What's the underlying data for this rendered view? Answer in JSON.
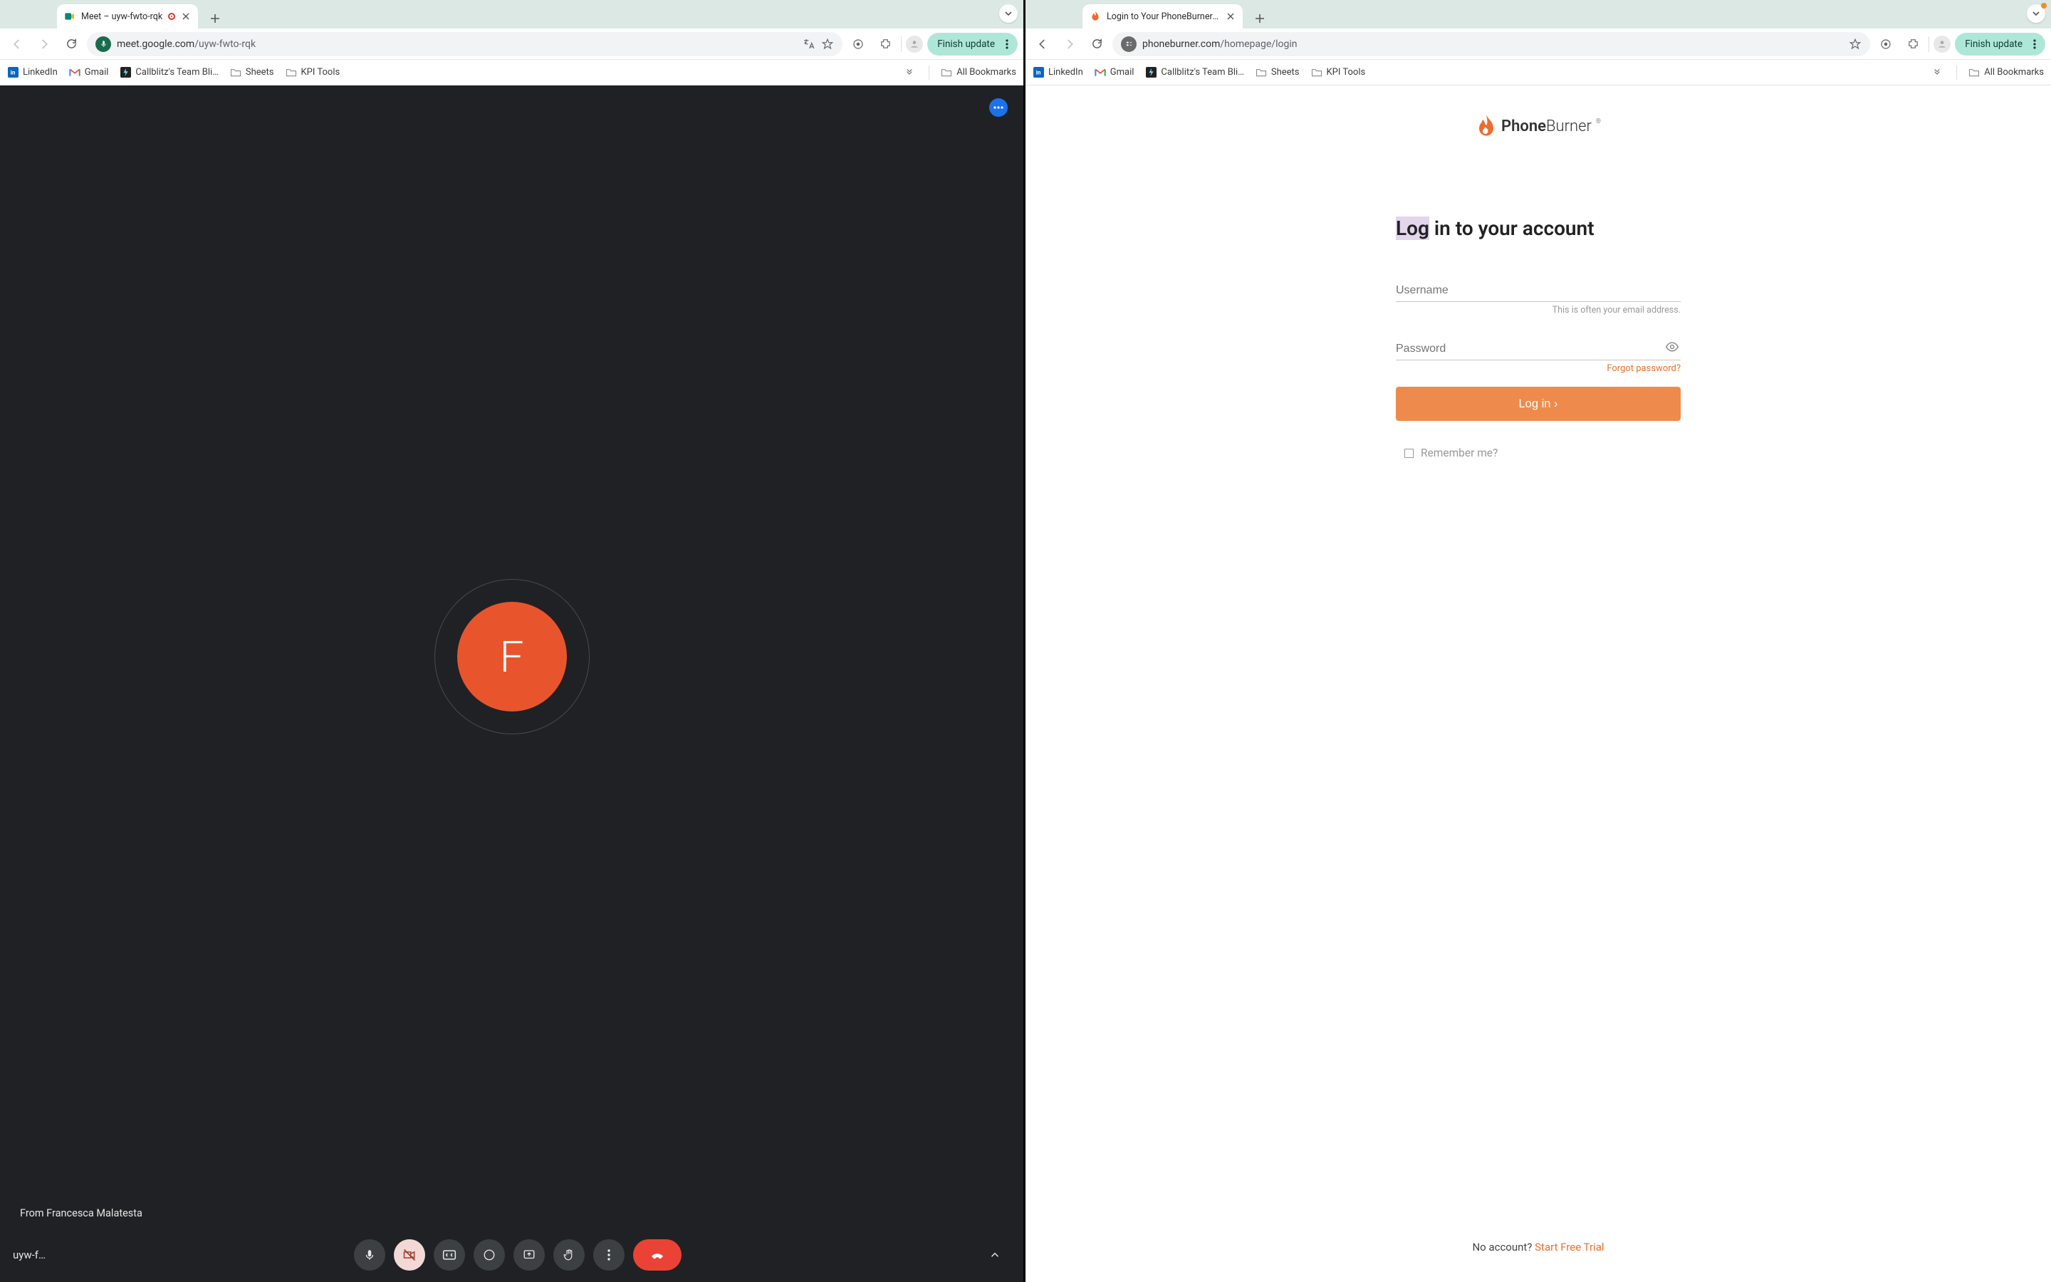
{
  "left": {
    "tab": {
      "title": "Meet – uyw-fwto-rqk"
    },
    "url": {
      "host": "meet.google.com",
      "path": "/uyw-fwto-rqk"
    },
    "finish_label": "Finish update",
    "bookmarks": [
      "LinkedIn",
      "Gmail",
      "Callblitz's Team Bli…",
      "Sheets",
      "KPI Tools"
    ],
    "all_bookmarks": "All Bookmarks",
    "avatar_initial": "F",
    "caption": "From Francesca Malatesta",
    "meeting_code": "uyw-f…"
  },
  "right": {
    "tab": {
      "title": "Login to Your PhoneBurner Ac"
    },
    "url": {
      "host": "phoneburner.com",
      "path": "/homepage/login"
    },
    "finish_label": "Finish update",
    "bookmarks": [
      "LinkedIn",
      "Gmail",
      "Callblitz's Team Bli…",
      "Sheets",
      "KPI Tools"
    ],
    "all_bookmarks": "All Bookmarks",
    "logo": {
      "bold": "Phone",
      "light": "Burner"
    },
    "heading": {
      "sel": "Log",
      "rest": " in to your account"
    },
    "username_label": "Username",
    "username_hint": "This is often your email address.",
    "password_label": "Password",
    "forgot": "Forgot password?",
    "login_btn": "Log in ›",
    "remember": "Remember me?",
    "footer_q": "No account? ",
    "footer_link": "Start Free Trial"
  }
}
